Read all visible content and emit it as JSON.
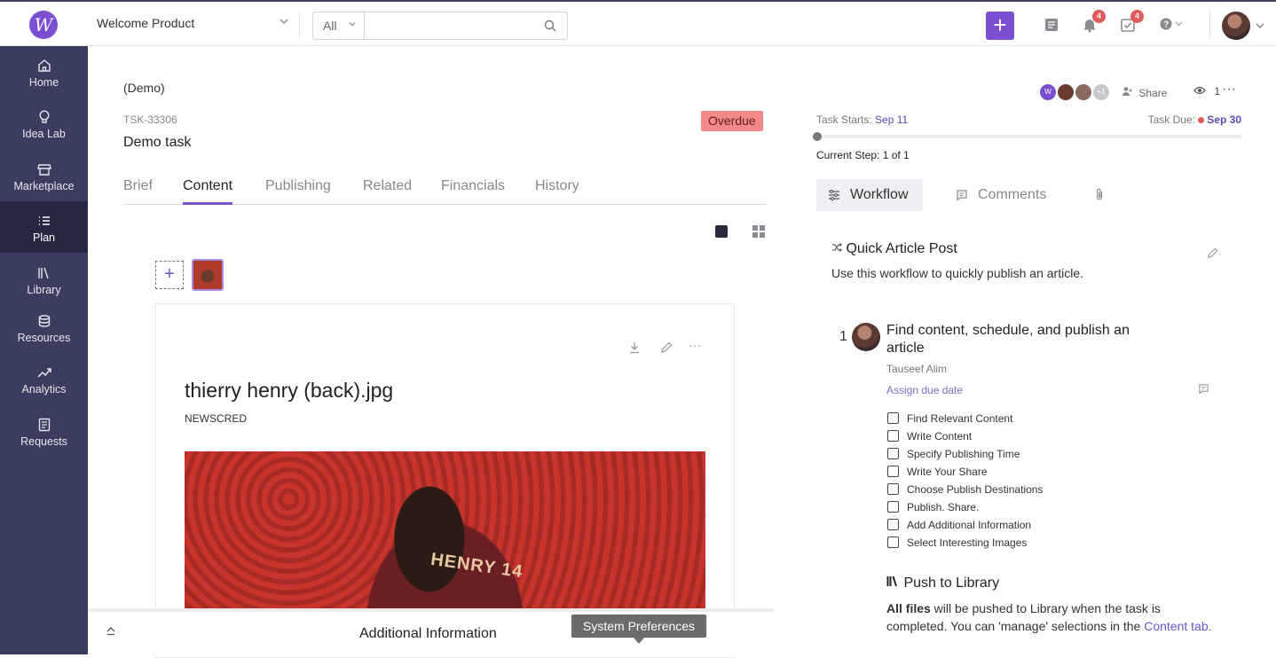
{
  "topbar": {
    "logo_letter": "W",
    "workspace": "Welcome Product",
    "search_scope": "All",
    "search_placeholder": "",
    "add_label": "+",
    "notifications_count": "4",
    "tasks_count": "4"
  },
  "sidebar": {
    "items": [
      {
        "label": "Home",
        "icon": "home-icon"
      },
      {
        "label": "Idea Lab",
        "icon": "lightbulb-icon"
      },
      {
        "label": "Marketplace",
        "icon": "store-icon"
      },
      {
        "label": "Plan",
        "icon": "list-icon",
        "active": true
      },
      {
        "label": "Library",
        "icon": "library-icon"
      },
      {
        "label": "Resources",
        "icon": "database-icon"
      },
      {
        "label": "Analytics",
        "icon": "trend-icon"
      },
      {
        "label": "Requests",
        "icon": "document-icon"
      }
    ]
  },
  "task": {
    "project": "(Demo)",
    "id": "TSK-33306",
    "title": "Demo task",
    "status": "Overdue"
  },
  "tabs": [
    "Brief",
    "Content",
    "Publishing",
    "Related",
    "Financials",
    "History"
  ],
  "asset": {
    "add_label": "+",
    "filename": "thierry henry (back).jpg",
    "source": "NEWSCRED",
    "jersey_text": "HENRY 14"
  },
  "bottom": {
    "collapse_label": "⌃",
    "label": "Additional Information",
    "tooltip": "System Preferences"
  },
  "right": {
    "avatar_more": "+1",
    "share_label": "Share",
    "watchers": "1",
    "more": "···",
    "starts_label": "Task Starts:",
    "starts_date": "Sep 11",
    "due_label": "Task Due:",
    "due_date": "Sep 30",
    "current_step": "Current Step: 1 of 1",
    "progress": 0.0,
    "tabs": [
      "Workflow",
      "Comments"
    ],
    "workflow_title": "Quick Article Post",
    "workflow_desc": "Use this workflow to quickly publish an article.",
    "step_number": "1",
    "step_title": "Find content, schedule, and publish an article",
    "step_owner": "Tauseef Alim",
    "assign_due": "Assign due date",
    "checklist": [
      "Find Relevant Content",
      "Write Content",
      "Specify Publishing Time",
      "Write Your Share",
      "Choose Publish Destinations",
      "Publish. Share.",
      "Add Additional Information",
      "Select Interesting Images"
    ],
    "push_title": "Push to Library",
    "push_bold": "All files",
    "push_text": " will be pushed to Library when the task is completed. You can 'manage' selections in the ",
    "push_link": "Content tab",
    "push_end": "."
  },
  "colors": {
    "accent": "#7a4fd1",
    "sidebar": "#3b3d5f",
    "sidebar_active": "#262842",
    "overdue": "#f28a8a"
  }
}
